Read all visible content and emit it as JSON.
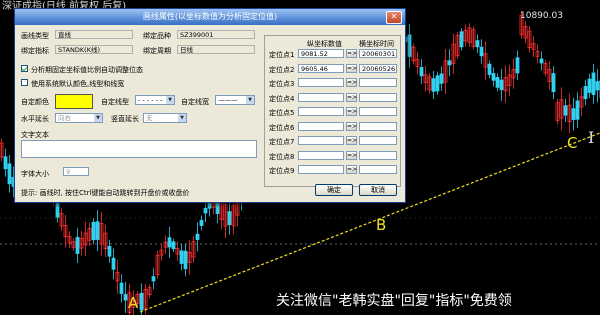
{
  "window": {
    "title": "深证成指(日线 前复权 后复)"
  },
  "chart": {
    "high_label": "10890.03",
    "points": [
      "A",
      "B",
      "C"
    ],
    "colors": {
      "up": "#ff3030",
      "down": "#30d0f0",
      "trendline": "#f0e020",
      "dash": "#cccccc"
    }
  },
  "dialog": {
    "title": "画线属性(以坐标数值为分析固定位值)",
    "close_icon": "✕",
    "type_label": "画线类型",
    "type_value": "直线",
    "product_label": "绑定品种",
    "product_value": "SZ399001",
    "index_label": "绑定指标",
    "index_value": "STANDK(K线)",
    "period_label": "绑定周期",
    "period_value": "日线",
    "chk_save_label": "分析期固定坐标值比例自动调整位态",
    "chk_default_label": "使用系统默认颜色,线型和线宽",
    "color_label": "自定颜色",
    "color_value": "#ffff00",
    "style_label": "自定线型",
    "width_label": "自定线宽",
    "hextend_label": "水平延长",
    "hextend_value": "向右",
    "vextend_label": "竖直延长",
    "vextend_value": "无",
    "text_label": "文字文本",
    "fontsize_label": "字体大小",
    "fontsize_value": "9",
    "hint": "提示: 画线时, 按住Ctrl键能自动跳转到开盘价或收盘价",
    "ok_label": "确定",
    "cancel_label": "取消",
    "grid": {
      "header_value": "纵坐标数值",
      "header_time": "横坐标时间",
      "rows": [
        {
          "label": "定位点1",
          "value": "9081.52",
          "time": "20060301"
        },
        {
          "label": "定位点2",
          "value": "9605.46",
          "time": "20060526"
        },
        {
          "label": "定位点3",
          "value": "",
          "time": ""
        },
        {
          "label": "定位点4",
          "value": "",
          "time": ""
        },
        {
          "label": "定位点5",
          "value": "",
          "time": ""
        },
        {
          "label": "定位点6",
          "value": "",
          "time": ""
        },
        {
          "label": "定位点7",
          "value": "",
          "time": ""
        },
        {
          "label": "定位点8",
          "value": "",
          "time": ""
        },
        {
          "label": "定位点9",
          "value": "",
          "time": ""
        }
      ],
      "arrow": "=>"
    }
  },
  "watermark": "关注微信\"老韩实盘\"回复\"指标\"免费领"
}
